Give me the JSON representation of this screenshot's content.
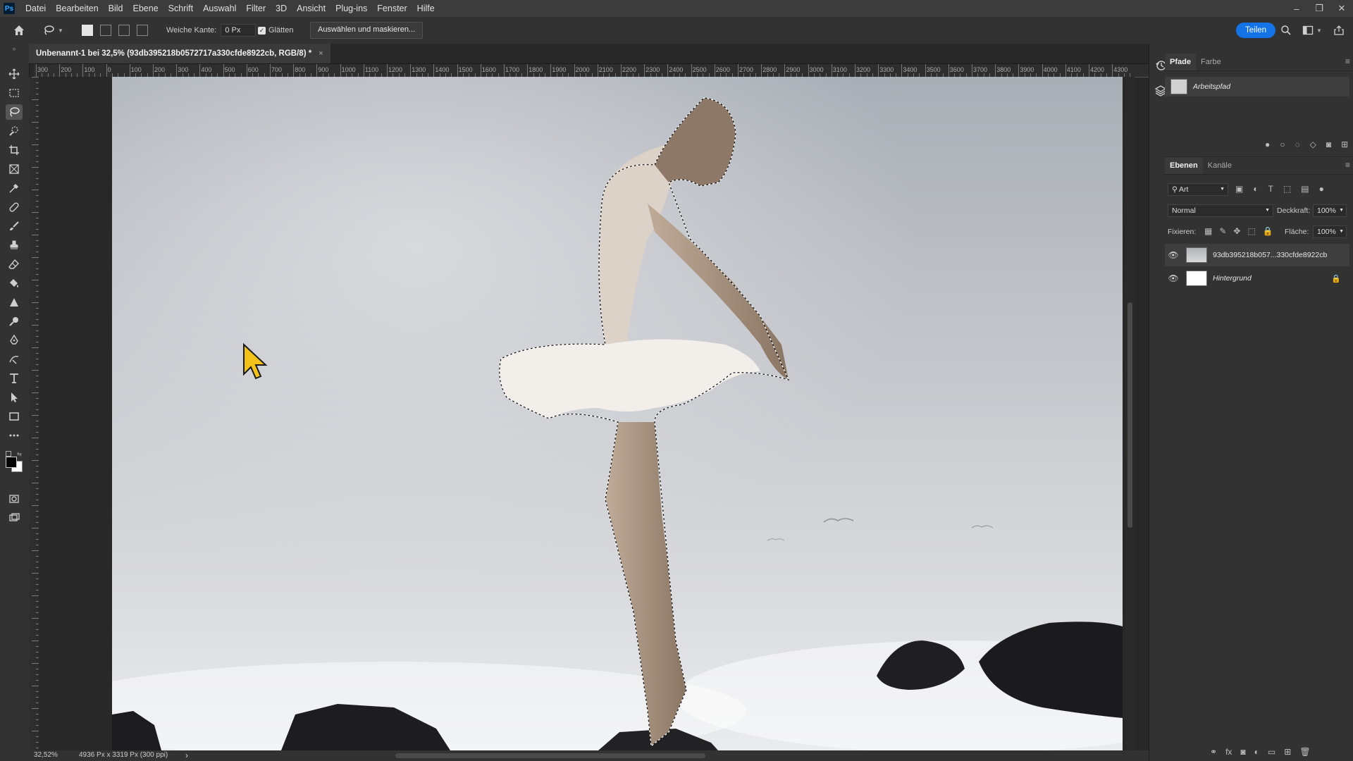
{
  "app": {
    "logo_text": "Ps"
  },
  "menu": [
    "Datei",
    "Bearbeiten",
    "Bild",
    "Ebene",
    "Schrift",
    "Auswahl",
    "Filter",
    "3D",
    "Ansicht",
    "Plug-ins",
    "Fenster",
    "Hilfe"
  ],
  "window_controls": {
    "minimize": "–",
    "restore": "❐",
    "close": "✕"
  },
  "options": {
    "feather_label": "Weiche Kante:",
    "feather_value": "0 Px",
    "antialias_label": "Glätten",
    "select_mask_label": "Auswählen und maskieren...",
    "share_label": "Teilen"
  },
  "document": {
    "tab_title": "Unbenannt-1 bei 32,5% (93db395218b0572717a330cfde8922cb, RGB/8) *",
    "close": "×"
  },
  "ruler": {
    "h_labels": [
      "300",
      "200",
      "100",
      "0",
      "100",
      "200",
      "300",
      "400",
      "500",
      "600",
      "700",
      "800",
      "900",
      "1000",
      "1100",
      "1200",
      "1300",
      "1400",
      "1500",
      "1600",
      "1700",
      "1800",
      "1900",
      "2000",
      "2100",
      "2200",
      "2300",
      "2400",
      "2500",
      "2600",
      "2700",
      "2800",
      "2900",
      "3000",
      "3100",
      "3200",
      "3300",
      "3400",
      "3500",
      "3600",
      "3700",
      "3800",
      "3900",
      "4000",
      "4100",
      "4200",
      "4300"
    ]
  },
  "status": {
    "zoom": "32,52%",
    "doc_size": "4936 Px x 3319 Px (300 ppi)",
    "arrow": "›"
  },
  "paths_panel": {
    "tabs": [
      "Pfade",
      "Farbe"
    ],
    "active_tab": "Pfade",
    "items": [
      {
        "name": "Arbeitspfad"
      }
    ]
  },
  "layers_panel": {
    "tabs": [
      "Ebenen",
      "Kanäle"
    ],
    "active_tab": "Ebenen",
    "filter_label": "Art",
    "blend_mode": "Normal",
    "opacity_label": "Deckkraft:",
    "opacity_value": "100%",
    "lock_label": "Fixieren:",
    "fill_label": "Fläche:",
    "fill_value": "100%",
    "layers": [
      {
        "name": "93db395218b057...330cfde8922cb",
        "selected": true,
        "locked": false
      },
      {
        "name": "Hintergrund",
        "selected": false,
        "locked": true
      }
    ]
  },
  "colors": {
    "accent": "#1473e6",
    "cursor": "#f2c21b"
  }
}
